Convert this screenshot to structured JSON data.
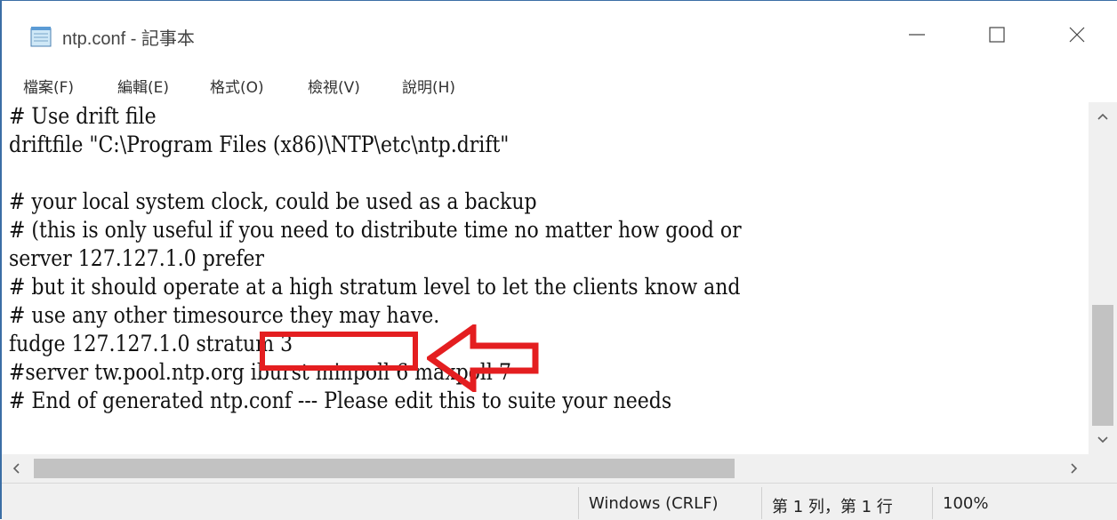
{
  "window": {
    "title": "ntp.conf - 記事本",
    "minimize_glyph": "—",
    "maximize_glyph": "☐",
    "close_glyph": "✕"
  },
  "menu": {
    "items": [
      {
        "label": "檔案(F)"
      },
      {
        "label": "編輯(E)"
      },
      {
        "label": "格式(O)"
      },
      {
        "label": "檢視(V)"
      },
      {
        "label": "說明(H)"
      }
    ]
  },
  "editor": {
    "lines": [
      "# Use drift file",
      "driftfile \"C:\\Program Files (x86)\\NTP\\etc\\ntp.drift\"",
      "",
      "# your local system clock, could be used as a backup",
      "# (this is only useful if you need to distribute time no matter how good or",
      "server 127.127.1.0 prefer",
      "# but it should operate at a high stratum level to let the clients know and",
      "# use any other timesource they may have.",
      "fudge 127.127.1.0 stratum 3",
      "#server tw.pool.ntp.org iburst minpoll 6 maxpoll 7",
      "# End of generated ntp.conf --- Please edit this to suite your needs"
    ]
  },
  "annotation": {
    "highlight_color": "#e41e20"
  },
  "statusbar": {
    "line_ending": "Windows (CRLF)",
    "cursor_position": "第 1 列，第 1 行",
    "zoom": "100%"
  }
}
